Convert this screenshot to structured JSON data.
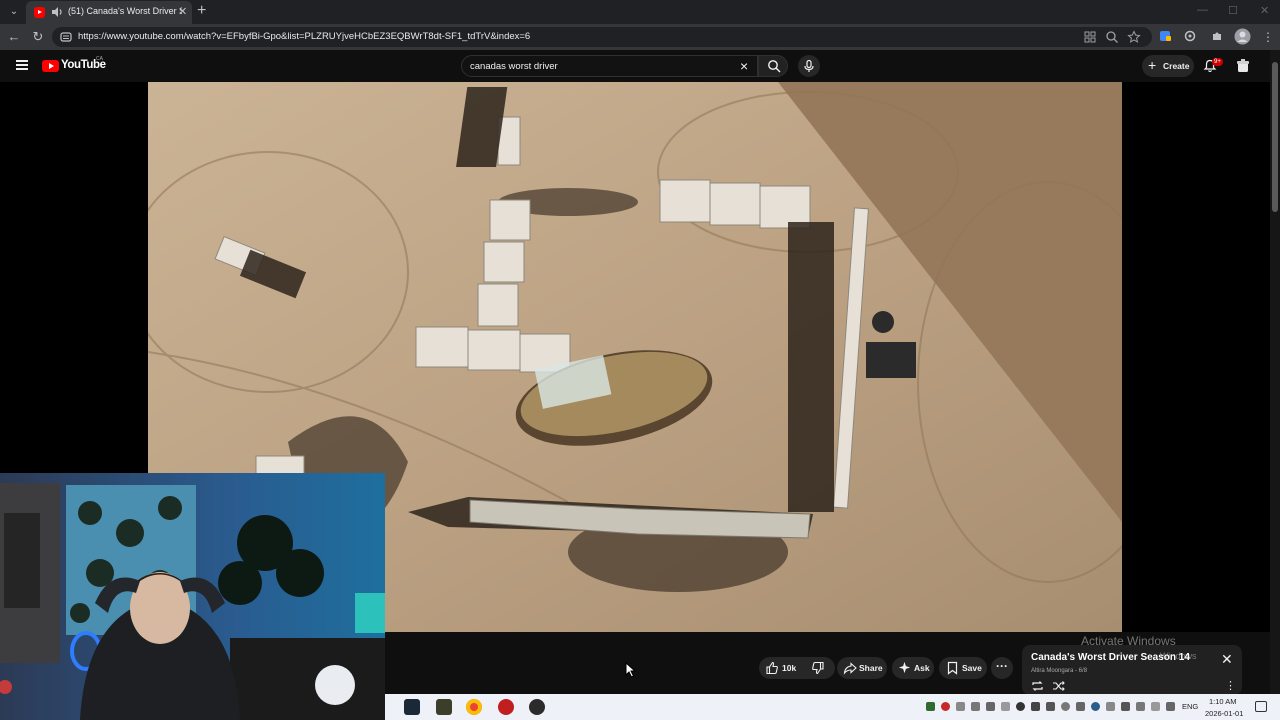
{
  "browser": {
    "tab": {
      "title": "(51) Canada's Worst Driver S",
      "favicon": "youtube-icon",
      "audio": "speaker-icon"
    },
    "url": "https://www.youtube.com/watch?v=EFbyfBi-Gpo&list=PLZRUYjveHCbEZ3EQBWrT8dt-SF1_tdTrV&index=6",
    "window_controls": [
      "—",
      "☐",
      "✕"
    ]
  },
  "youtube": {
    "logo_text": "YouTube",
    "region": "CA",
    "search": {
      "query": "canadas worst driver"
    },
    "create_label": "Create",
    "notification_badge": "9+",
    "accent": "#ff0000"
  },
  "actions": {
    "likes": "10k",
    "share": "Share",
    "ask": "Ask",
    "save": "Save"
  },
  "playlist": {
    "title": "Canada's Worst Driver Season 14",
    "subtitle": "Altira Moongara - 6/8"
  },
  "watermark": {
    "line1": "Activate Windows",
    "line2": "Windows"
  },
  "taskbar": {
    "language": "ENG",
    "time": "1:10 AM",
    "date": "2026-01-01"
  }
}
